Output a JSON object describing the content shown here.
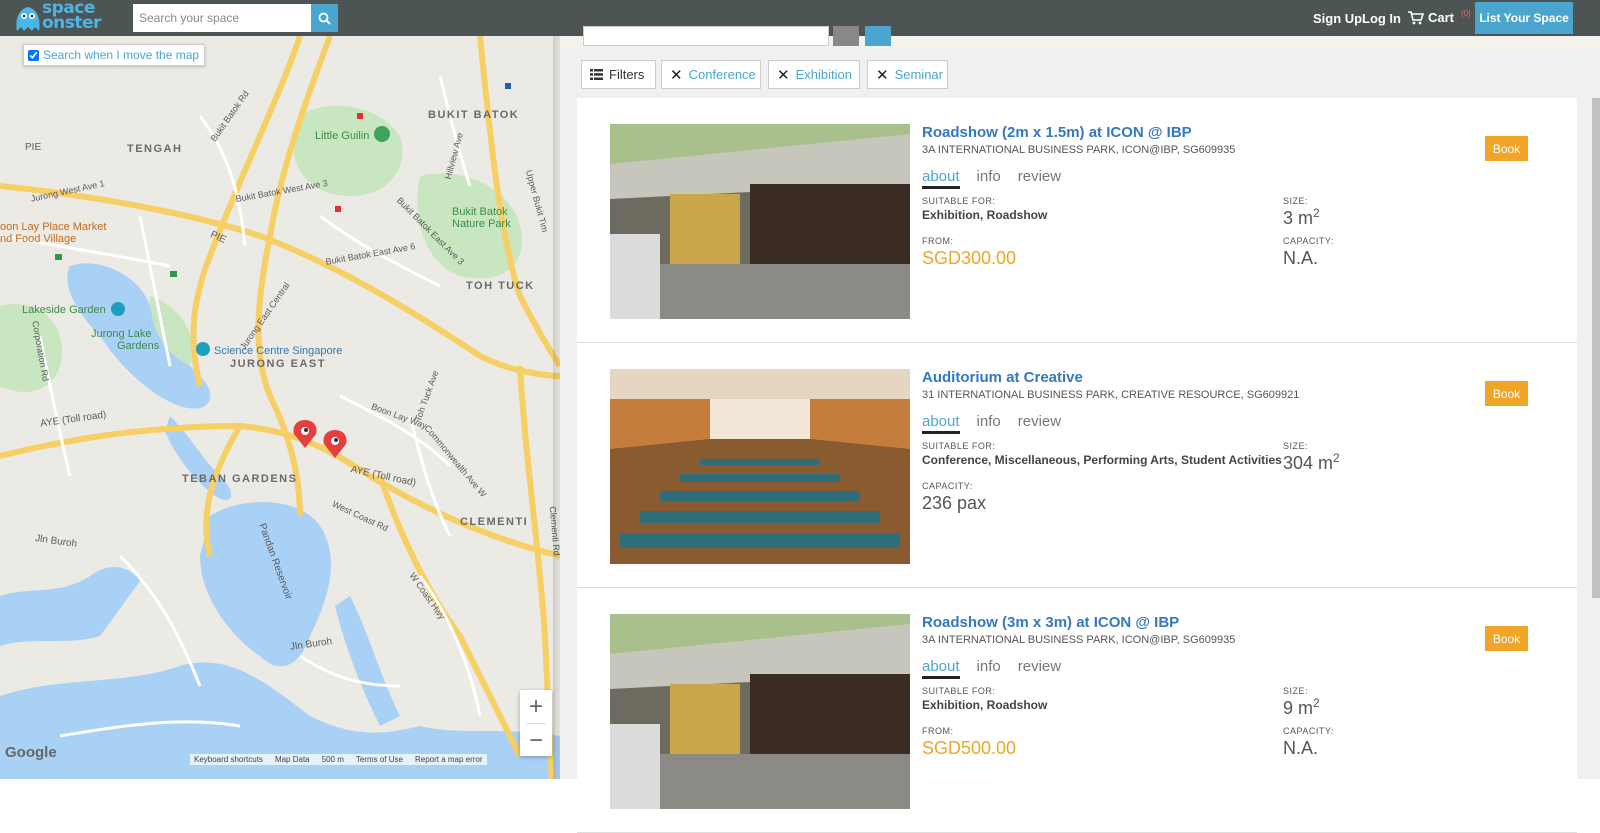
{
  "header": {
    "logo_line1": "space",
    "logo_line2": "onster",
    "search_placeholder": "Search your space",
    "sign_up": "Sign Up",
    "log_in": "Log In",
    "cart_label": "Cart",
    "cart_count": "(0)",
    "list_space": "List Your Space"
  },
  "map": {
    "search_when_move": "Search when I move the map",
    "search_when_move_checked": true,
    "labels": {
      "bukit_batok": "BUKIT BATOK",
      "tengah": "TENGAH",
      "toh_tuck": "TOH TUCK",
      "jurong_east": "JURONG EAST",
      "teban_gardens": "TEBAN GARDENS",
      "clementi": "CLEMENTI",
      "little_guilin": "Little Guilin",
      "bukit_batok_nature_park_1": "Bukit Batok",
      "bukit_batok_nature_park_2": "Nature Park",
      "lakeside_garden": "Lakeside Garden",
      "jurong_lake_gardens_1": "Jurong Lake",
      "jurong_lake_gardens_2": "Gardens",
      "science_centre": "Science Centre Singapore",
      "market_1": "oon Lay Place Market",
      "market_2": "nd Food Village",
      "pandan_reservoir": "Pandan Reservoir",
      "aye1": "AYE (Toll road)",
      "aye2": "AYE (Toll road)",
      "pie1": "PIE",
      "pie2": "PIE",
      "boon_lay_way": "Boon Lay Way",
      "jln_buroh1": "Jln Buroh",
      "jln_buroh2": "Jln Buroh",
      "w_coast_rd": "West Coast Rd",
      "w_coast_hwy": "W Coast Hwy",
      "clementi_rd": "Clementi Rd",
      "jurong_west_ave1": "Jurong West Ave 1",
      "bukit_batok_rd": "Bukit Batok Rd",
      "bukit_batok_west_ave3": "Bukit Batok West Ave 3",
      "bukit_batok_east_ave6": "Bukit Batok East Ave 6",
      "bukit_batok_east_ave3": "Bukit Batok East Ave 3",
      "jurong_east_central": "Jurong East Central",
      "toh_tuck_ave": "Toh Tuck Ave",
      "commonwealth_ave_w": "Commonwealth Ave W",
      "upper_bukit_timah": "Upper Bukit Tim",
      "hillview_ave": "Hillview Ave",
      "corporation_rd": "Corporation Rd"
    },
    "zoom_in": "+",
    "zoom_out": "−",
    "google": "Google",
    "footer": [
      "Keyboard shortcuts",
      "Map Data",
      "500 m",
      "Terms of Use",
      "Report a map error"
    ]
  },
  "filters": {
    "filters_label": "Filters",
    "chips": [
      "Conference",
      "Exhibition",
      "Seminar"
    ]
  },
  "listings": [
    {
      "title": "Roadshow (2m x 1.5m) at ICON @ IBP",
      "address": "3A INTERNATIONAL BUSINESS PARK, ICON@IBP, SG609935",
      "tabs": [
        "about",
        "info",
        "review"
      ],
      "suitable_label": "SUITABLE FOR:",
      "suitable": "Exhibition, Roadshow",
      "size_label": "SIZE:",
      "size": "3 m",
      "size_sup": "2",
      "from_label": "FROM:",
      "price": "SGD300.00",
      "capacity_label": "CAPACITY:",
      "capacity": "N.A.",
      "book": "Book"
    },
    {
      "title": "Auditorium at Creative",
      "address": "31 INTERNATIONAL BUSINESS PARK, CREATIVE RESOURCE, SG609921",
      "tabs": [
        "about",
        "info",
        "review"
      ],
      "suitable_label": "SUITABLE FOR:",
      "suitable": "Conference, Miscellaneous, Performing Arts, Student Activities",
      "size_label": "SIZE:",
      "size": "304 m",
      "size_sup": "2",
      "capacity_label": "CAPACITY:",
      "capacity": "236 pax",
      "book": "Book"
    },
    {
      "title": "Roadshow (3m x 3m) at ICON @ IBP",
      "address": "3A INTERNATIONAL BUSINESS PARK, ICON@IBP, SG609935",
      "tabs": [
        "about",
        "info",
        "review"
      ],
      "suitable_label": "SUITABLE FOR:",
      "suitable": "Exhibition, Roadshow",
      "size_label": "SIZE:",
      "size": "9 m",
      "size_sup": "2",
      "from_label": "FROM:",
      "price": "SGD500.00",
      "capacity_label": "CAPACITY:",
      "capacity": "N.A.",
      "book": "Book"
    }
  ]
}
